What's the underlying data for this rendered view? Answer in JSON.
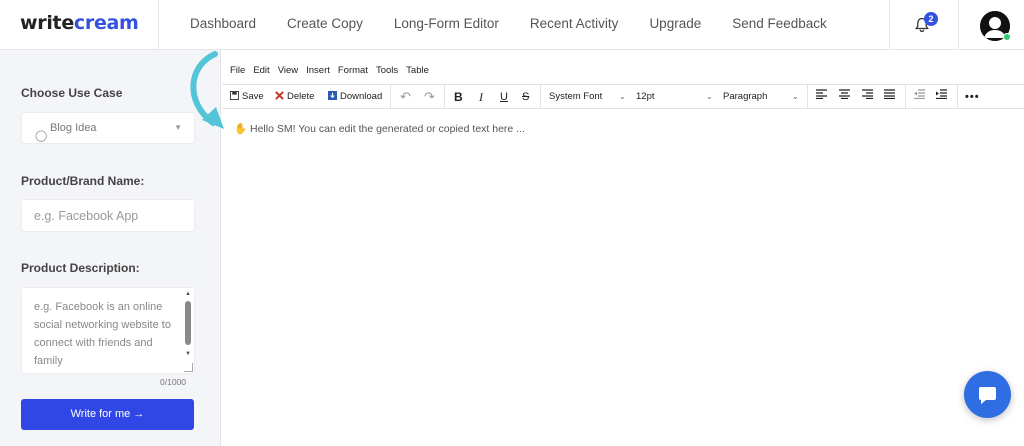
{
  "brand": {
    "logo_dark": "write",
    "logo_accent": "cream",
    "accent_color": "#3352e0"
  },
  "nav": [
    "Dashboard",
    "Create Copy",
    "Long-Form Editor",
    "Recent Activity",
    "Upgrade",
    "Send Feedback"
  ],
  "notifications": {
    "count": "2"
  },
  "sidebar": {
    "use_case_label": "Choose Use Case",
    "use_case_value": "Blog Idea",
    "brand_name_label": "Product/Brand Name:",
    "brand_name_placeholder": "e.g. Facebook App",
    "description_label": "Product Description:",
    "description_placeholder": "e.g. Facebook is an online social networking website to connect with friends and family",
    "char_counter": "0/1000",
    "submit_label": "Write for me →",
    "submit_color": "#3047e6"
  },
  "editor": {
    "menu": [
      "File",
      "Edit",
      "View",
      "Insert",
      "Format",
      "Tools",
      "Table"
    ],
    "toolbar": {
      "save": "Save",
      "delete": "Delete",
      "download": "Download",
      "font": "System Font",
      "size": "12pt",
      "block": "Paragraph"
    },
    "placeholder_text": "Hello SM! You can edit the generated or copied text here ..."
  },
  "icons": [
    "bell-icon",
    "avatar-icon",
    "lightbulb-icon",
    "save-icon",
    "delete-icon",
    "download-icon",
    "undo-icon",
    "redo-icon",
    "bold-icon",
    "italic-icon",
    "underline-icon",
    "strikethrough-icon",
    "align-left-icon",
    "align-center-icon",
    "align-right-icon",
    "align-justify-icon",
    "outdent-icon",
    "indent-icon",
    "more-icon",
    "chat-icon",
    "arrow-pointer-icon"
  ]
}
